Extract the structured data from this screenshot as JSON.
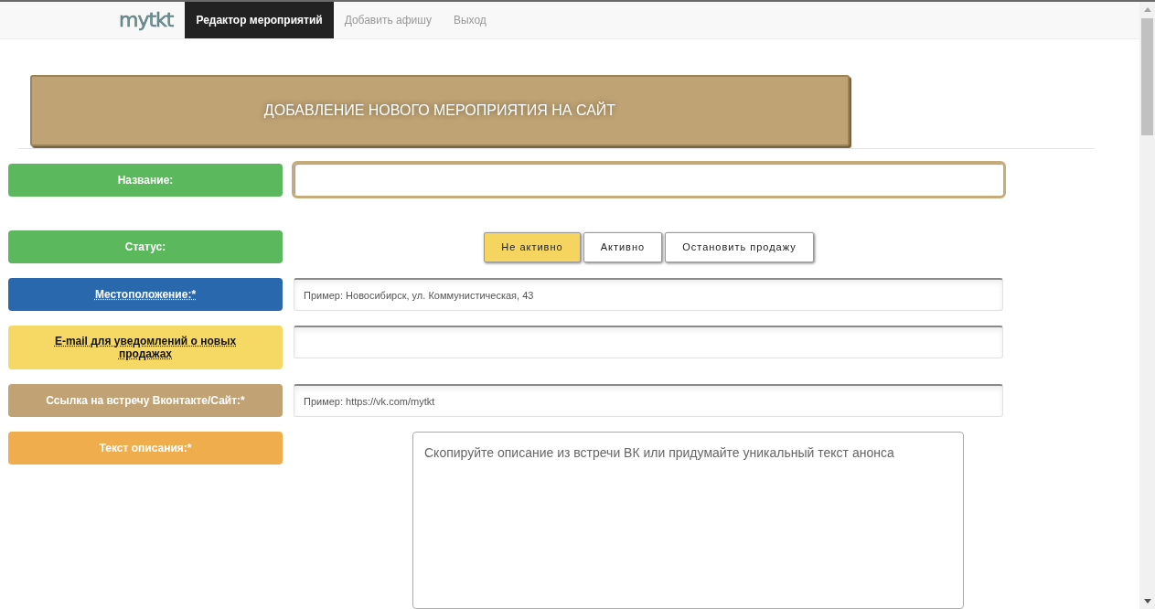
{
  "navbar": {
    "logo": "mytkt",
    "items": [
      {
        "label": "Редактор мероприятий",
        "selected": true
      },
      {
        "label": "Добавить афишу",
        "selected": false
      },
      {
        "label": "Выход",
        "selected": false
      }
    ]
  },
  "header": {
    "title": "ДОБАВЛЕНИЕ НОВОГО МЕРОПРИЯТИЯ НА САЙТ"
  },
  "form": {
    "rows": [
      {
        "kind": "input",
        "label": "Название:",
        "color": "#5cb85c",
        "underlined": false,
        "focused": true
      },
      {
        "kind": "status",
        "label": "Статус:",
        "color": "#5cb85c",
        "underlined": false,
        "options": [
          {
            "label": "Не активно",
            "selected": true
          },
          {
            "label": "Активно",
            "selected": false
          },
          {
            "label": "Остановить продажу",
            "selected": false
          }
        ]
      },
      {
        "kind": "input",
        "label": "Местоположение:*",
        "color": "#2a68ae",
        "underlined": true,
        "focused": false,
        "placeholder": "Пример: Новосибирск, ул. Коммунистическая, 43"
      },
      {
        "kind": "input",
        "label": "E-mail для уведомлений о новых продажах",
        "color": "#f6d865",
        "underlined": true,
        "focused": false
      },
      {
        "kind": "input",
        "label": "Ссылка на встречу Вконтакте/Сайт:*",
        "color": "#c0a274",
        "underlined": false,
        "focused": false,
        "placeholder": "Пример: https://vk.com/mytkt"
      },
      {
        "kind": "textarea",
        "label": "Текст описания:*",
        "color": "#f0ad4e",
        "underlined": false,
        "focused": false,
        "placeholder": "Скопируйте описание из встречи ВК или придумайте уникальный текст анонса"
      }
    ]
  }
}
